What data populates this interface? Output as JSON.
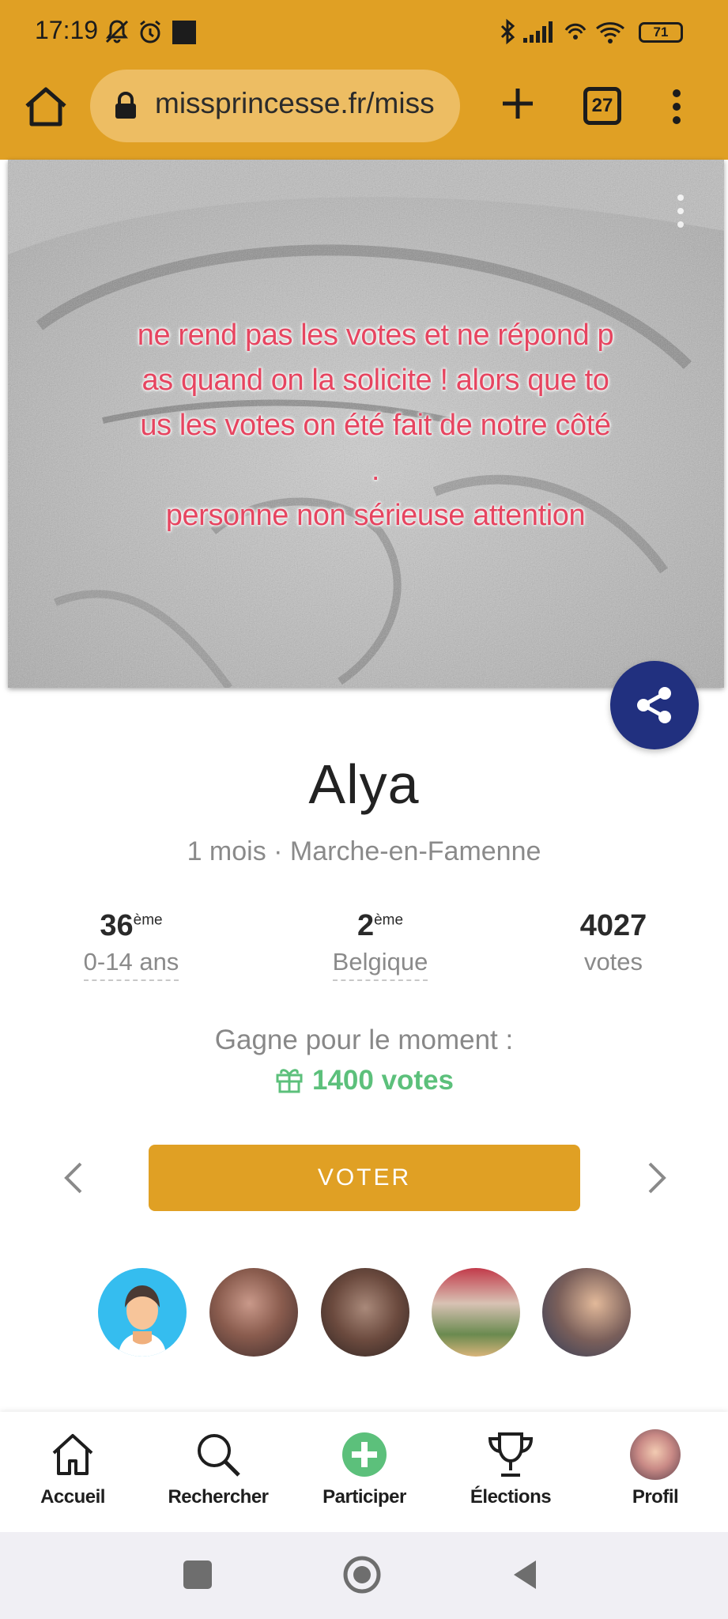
{
  "status_bar": {
    "time": "17:19",
    "battery": "71"
  },
  "browser": {
    "url": "missprincesse.fr/miss",
    "tab_count": "27"
  },
  "photo": {
    "overlay_text": "ne rend pas les votes et ne répond p\nas quand on la solicite ! alors que to\nus les votes on été fait de notre côté\n.\npersonne non sérieuse attention"
  },
  "profile": {
    "name": "Alya",
    "meta": "1 mois · Marche-en-Famenne",
    "stats": [
      {
        "value": "36",
        "suffix": "ème",
        "label": "0-14 ans"
      },
      {
        "value": "2",
        "suffix": "ème",
        "label": "Belgique"
      },
      {
        "value": "4027",
        "suffix": "",
        "label": "votes"
      }
    ],
    "gain_label": "Gagne pour le moment :",
    "gain_votes": "1400 votes",
    "vote_button": "VOTER"
  },
  "bottom_nav": {
    "items": [
      {
        "label": "Accueil",
        "icon": "home-icon"
      },
      {
        "label": "Rechercher",
        "icon": "search-icon"
      },
      {
        "label": "Participer",
        "icon": "plus-circle-icon"
      },
      {
        "label": "Élections",
        "icon": "trophy-icon"
      },
      {
        "label": "Profil",
        "icon": "avatar"
      }
    ]
  },
  "colors": {
    "brand": "#e0a024",
    "share": "#21307f",
    "success": "#5cc07b",
    "overlay_text": "#e64560"
  }
}
